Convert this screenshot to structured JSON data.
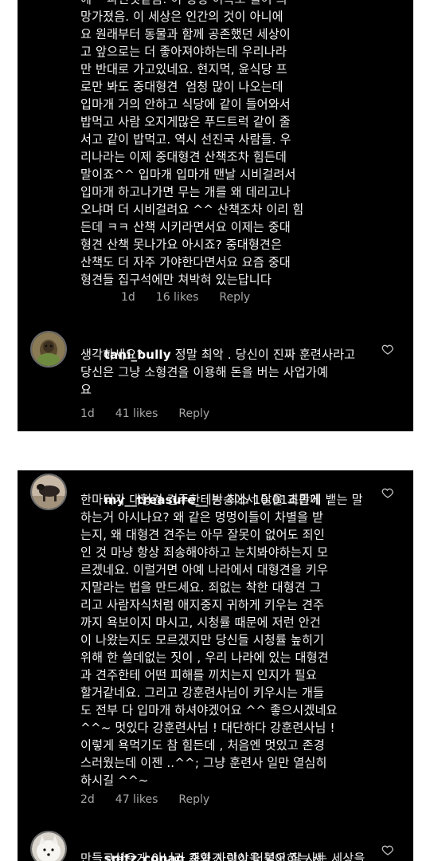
{
  "comments": [
    {
      "username": "",
      "lines": [
        "망가졌음. 이 세상은 인간의 것이 아니에",
        "요 원래부터 동물과 함께 공존했던 세상이",
        "고 앞으로는 더 좋아져야하는데 우리나라",
        "만 반대로 가고있네요. 현지먹, 윤식당 프",
        "로만 봐도 중대형견  엄청 많이 나오는데",
        "입마개 거의 안하고 식당에 같이 들어와서",
        "밥먹고 사람 오지게많은 푸드트럭 같이 줄",
        "서고 같이 밥먹고. 역시 선진국 사람들. 우",
        "리나라는 이제 중대형견 산책조차 힘든데",
        "말이죠^^ 입마개 입마개 맨날 시비걸려서",
        "입마개 하고나가면 무는 개를 왜 데리고나",
        "오냐며 더 시비걸려요 ^^ 산책조차 이리 힘",
        "든데 ㅋㅋ 산책 시키라면서요 이제는 중대",
        "형견 산책 못나가요 아시죠? 중대형견은",
        "산책도 더 자주 가야한다면서요 요즘 중대",
        "형견들 집구석에만 쳐박혀 있는답니다"
      ],
      "age": "1d",
      "likes": "16 likes",
      "reply": "Reply"
    },
    {
      "username": "tani_bully",
      "first_line": "정말 최악 . 당신이 진짜 훈련사라고",
      "lines": [
        "생각하세요?",
        "당신은 그냥 소형견을 이용해 돈을 버는 사업가예",
        "요"
      ],
      "age": "1d",
      "likes": "41 likes",
      "reply": "Reply",
      "avatar_icon": "dog-avatar"
    },
    {
      "username": "my__treasure__",
      "first_line": "방송에서 0.01초만에 뱉는 말",
      "lines": [
        "한마디가 대형견 견주한테는 최소 1달을 괴롭게",
        "하는거 아시나요? 왜 같은 멍멍이들이 차별을 받",
        "는지, 왜 대형견 견주는 아무 잘못이 없어도 죄인",
        "인 것 마냥 항상 죄송해야하고 눈치봐야하는지 모",
        "르겠네요. 이럴거면 아예 나라에서 대형견을 키우",
        "지말라는 법을 만드세요. 죄없는 착한 대형견 그",
        "리고 사람자식처럼 애지중지 귀하게 키우는 견주",
        "까지 욕보이지 마시고, 시청률 때문에 저런 안건",
        "이 나왔는지도 모르겠지만 당신들 시청률 높히기",
        "위해 한 쓸데없는 짓이 , 우리 나라에 있는 대형견",
        "과 견주한테 어떤 피해를 끼치는지 인지가 필요",
        "할거같네요. 그리고 강훈련사님이 키우시는 개들",
        "도 전부 다 입마개 하셔야겠어요 ^^ 좋으시겠네요",
        "^^~ 멋있다 강훈련사님 ! 대단하다 강훈련사님 !",
        "이렇게 욕먹기도 참 힘든데 , 처음엔 멋있고 존경",
        "스러웠는데 이젠 ..^^; 그냥 훈련사 일만 열심히",
        "하시길 ^^~"
      ],
      "age": "2d",
      "likes": "47 likes",
      "reply": "Reply",
      "avatar_icon": "dog-avatar"
    },
    {
      "username": "spitz_conan",
      "first_line": "개와 사람이 더불어 잘 사는 세상을",
      "lines": [
        "만들고싶으게 아니라 중형견 이상을 혐오하는 세"
      ],
      "avatar_icon": "white-dog-avatar"
    }
  ],
  "colors": {
    "background": "#000000",
    "text": "#f2f2f2",
    "meta": "#a8a8a8"
  },
  "partial_top_line": "에 ㅡ파민것같음. 이 평청 이독로 뭘어 의"
}
